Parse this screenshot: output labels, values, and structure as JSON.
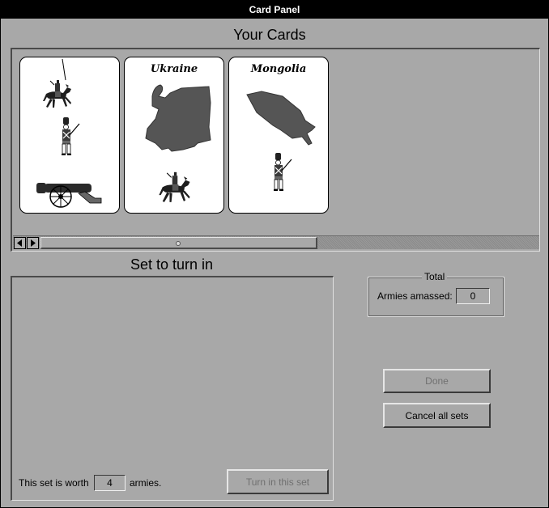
{
  "window": {
    "title": "Card Panel"
  },
  "cards_section": {
    "heading": "Your Cards",
    "cards": [
      {
        "territory": "",
        "units": [
          "cavalry",
          "infantry",
          "artillery"
        ]
      },
      {
        "territory": "Ukraine",
        "units": [
          "cavalry"
        ]
      },
      {
        "territory": "Mongolia",
        "units": [
          "infantry"
        ]
      }
    ]
  },
  "set_section": {
    "heading": "Set to turn in",
    "worth_prefix": "This set is worth",
    "worth_value": "4",
    "worth_suffix": "armies.",
    "turn_in_label": "Turn in this set"
  },
  "total": {
    "legend": "Total",
    "label": "Armies amassed:",
    "value": "0"
  },
  "buttons": {
    "done_label": "Done",
    "cancel_label": "Cancel all sets"
  },
  "icons": {
    "scroll_left": "arrow-left-icon",
    "scroll_right": "arrow-right-icon"
  },
  "colors": {
    "background": "#a8a8a8",
    "titlebar": "#000000",
    "card": "#ffffff",
    "territory": "#555555"
  }
}
